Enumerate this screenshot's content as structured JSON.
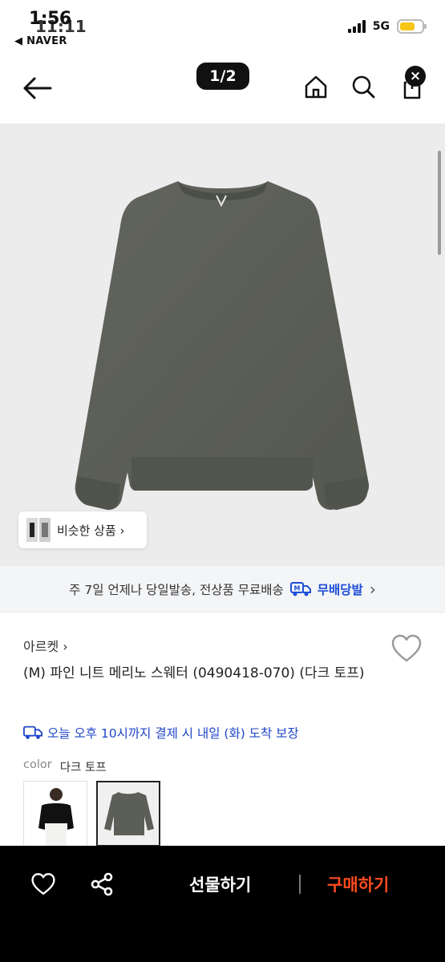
{
  "status_bar": {
    "time": "1:56",
    "time_overlay": "11:11",
    "back_app": "◀ NAVER",
    "network": "5G"
  },
  "header": {
    "page_indicator": "1/2"
  },
  "product_image": {
    "similar_products_label": "비슷한 상품 ›"
  },
  "shipping_banner": {
    "text": "주 7일 언제나 당일발송, 전상품 무료배송",
    "brand": "무배당발",
    "chevron": "›"
  },
  "product": {
    "brand": "아르켓 ›",
    "name": "(M) 파인 니트 메리노 스웨터 (0490418-070) (다크 토프)",
    "delivery": "오늘 오후 10시까지 결제 시 내일 (화) 도착 보장",
    "color_label": "color",
    "color_value": "다크 토프"
  },
  "bottom_bar": {
    "gift_label": "선물하기",
    "buy_label": "구매하기"
  },
  "colors": {
    "accent_blue": "#1d4ed8",
    "buy_orange": "#ff4b1f",
    "sweater": "#5c5f58"
  }
}
